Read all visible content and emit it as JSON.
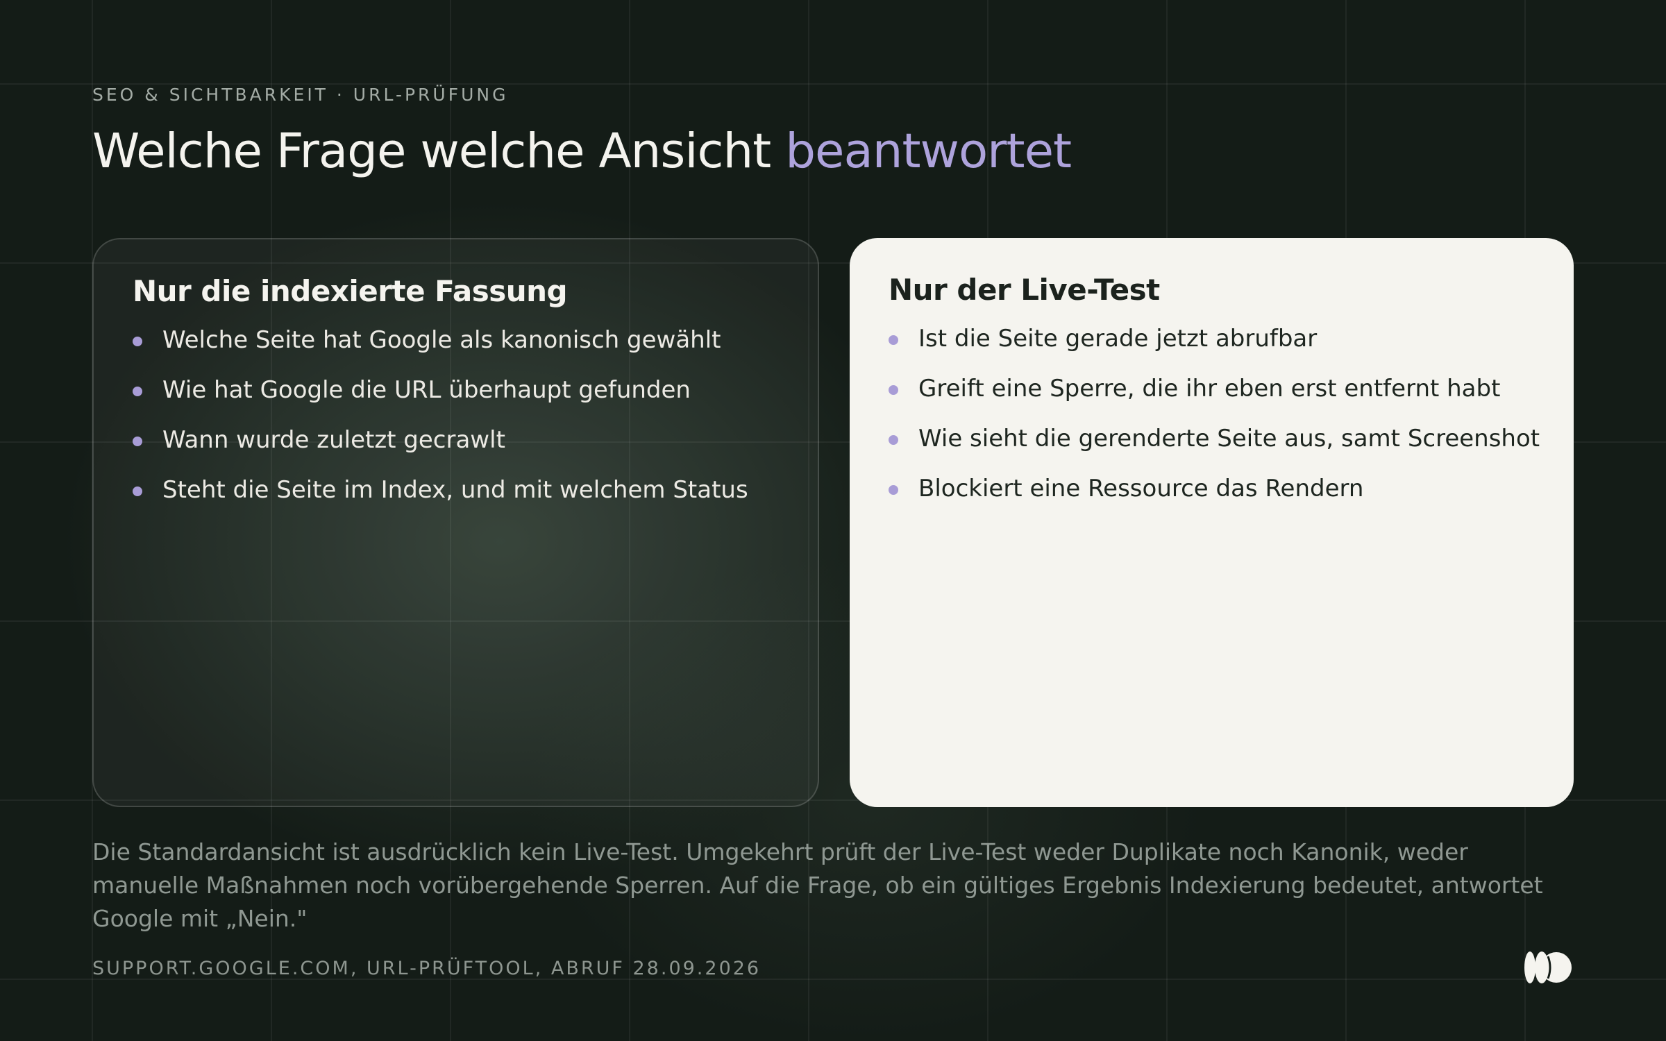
{
  "slide": {
    "eyebrow": "SEO & SICHTBARKEIT · URL-PRÜFUNG",
    "title_main": "Welche Frage welche Ansicht ",
    "title_accent": "beantwortet",
    "accent_color": "#aea3dc"
  },
  "cards": {
    "indexed": {
      "title": "Nur die indexierte Fassung",
      "items": [
        "Welche Seite hat Google als kanonisch gewählt",
        "Wie hat Google die URL überhaupt gefunden",
        "Wann wurde zuletzt gecrawlt",
        "Steht die Seite im Index, und mit welchem Status"
      ]
    },
    "live": {
      "title": "Nur der Live-Test",
      "items": [
        "Ist die Seite gerade jetzt abrufbar",
        "Greift eine Sperre, die ihr eben erst entfernt habt",
        "Wie sieht die gerenderte Seite aus, samt Screenshot",
        "Blockiert eine Ressource das Rendern"
      ]
    }
  },
  "footnote": "Die Standardansicht ist ausdrücklich kein Live-Test. Umgekehrt prüft der Live-Test weder Duplikate noch Kanonik, weder manuelle Maßnahmen noch vorübergehende Sperren. Auf die Frage, ob ein gültiges Ergebnis Indexierung bedeutet, antwortet Google mit „Nein.\"",
  "source": "SUPPORT.GOOGLE.COM, URL-PRÜFTOOL, ABRUF 28.09.2026",
  "logo_icon": "brand-logo-icon"
}
